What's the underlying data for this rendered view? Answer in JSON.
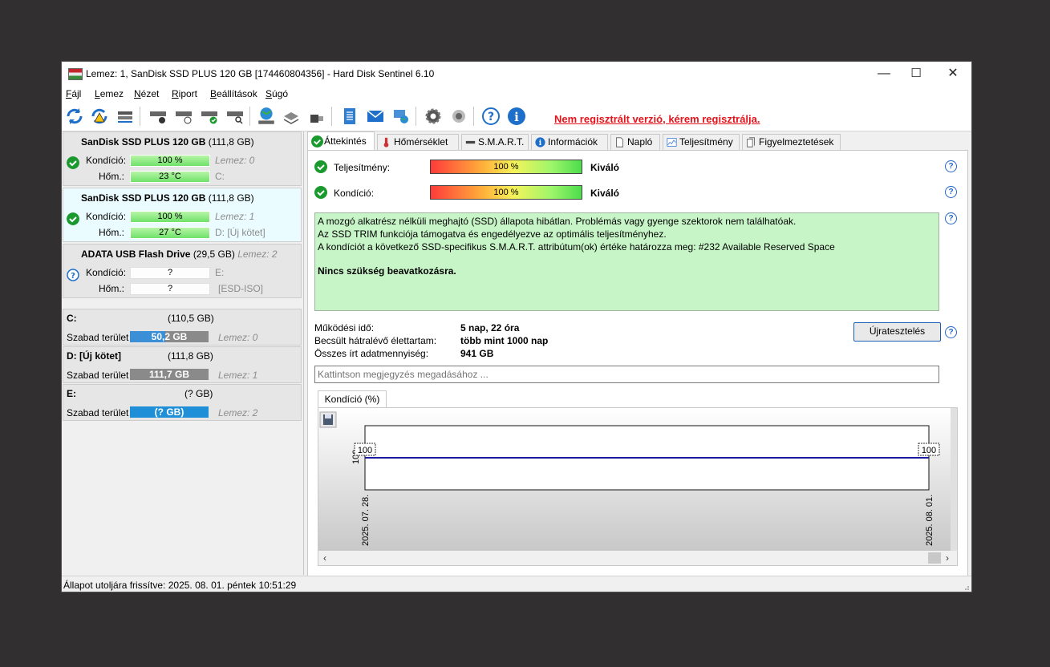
{
  "window": {
    "title": "Lemez: 1, SanDisk SSD PLUS 120 GB [174460804356]  -  Hard Disk Sentinel 6.10",
    "minimize": "—",
    "maximize": "☐",
    "close": "✕"
  },
  "menu": [
    "Fájl",
    "Lemez",
    "Nézet",
    "Riport",
    "Beállítások",
    "Súgó"
  ],
  "toolbar": {
    "register_link": "Nem regisztrált verzió, kérem regisztrálja."
  },
  "disks": [
    {
      "name": "SanDisk SSD PLUS 120 GB",
      "size": "(111,8 GB)",
      "lemez": "",
      "cond_label": "Kondíció:",
      "cond_value": "100 %",
      "cond_disk": "Lemez: 0",
      "temp_label": "Hőm.:",
      "temp_value": "23 °C",
      "drive": "C:"
    },
    {
      "name": "SanDisk SSD PLUS 120 GB",
      "size": "(111,8 GB)",
      "lemez": "",
      "cond_label": "Kondíció:",
      "cond_value": "100 %",
      "cond_disk": "Lemez: 1",
      "temp_label": "Hőm.:",
      "temp_value": "27 °C",
      "drive": "D: [Új kötet]"
    },
    {
      "name": "ADATA   USB Flash Drive",
      "size": "(29,5 GB)",
      "lemez": "Lemez: 2",
      "cond_label": "Kondíció:",
      "cond_value": "?",
      "cond_disk": "E:",
      "temp_label": "Hőm.:",
      "temp_value": "?",
      "drive": "[ESD-ISO]"
    }
  ],
  "volumes": [
    {
      "name": "C:",
      "size": "(110,5 GB)",
      "free_label": "Szabad terület",
      "free": "50,2 GB",
      "disk": "Lemez: 0",
      "color": "#3a8fd6"
    },
    {
      "name": "D: [Új kötet]",
      "size": "(111,8 GB)",
      "free_label": "Szabad terület",
      "free": "111,7 GB",
      "disk": "Lemez: 1",
      "color": "#8a8a8a"
    },
    {
      "name": "E:",
      "size": "(? GB)",
      "free_label": "Szabad terület",
      "free": "(? GB)",
      "disk": "Lemez: 2",
      "color": "#1f8fd8"
    }
  ],
  "tabs": [
    "Áttekintés",
    "Hőmérséklet",
    "S.M.A.R.T.",
    "Információk",
    "Napló",
    "Teljesítmény",
    "Figyelmeztetések"
  ],
  "overview": {
    "performance_label": "Teljesítmény:",
    "performance_value": "100 %",
    "performance_rating": "Kiváló",
    "condition_label": "Kondíció:",
    "condition_value": "100 %",
    "condition_rating": "Kiváló",
    "info_lines": [
      "A mozgó alkatrész nélküli meghajtó (SSD) állapota hibátlan. Problémás vagy gyenge szektorok nem találhatóak.",
      "Az SSD TRIM funkciója támogatva és engedélyezve az optimális teljesítményhez.",
      "A kondíciót a következő SSD-specifikus S.M.A.R.T. attribútum(ok) értéke határozza meg:  #232 Available Reserved Space"
    ],
    "info_bold": "Nincs szükség beavatkozásra.",
    "uptime_label": "Működési idő:",
    "uptime_value": "5 nap, 22 óra",
    "lifetime_label": "Becsült hátralévő élettartam:",
    "lifetime_value": "több mint 1000 nap",
    "written_label": "Összes írt adatmennyiség:",
    "written_value": "941 GB",
    "retest_button": "Újratesztelés",
    "note_placeholder": "Kattintson megjegyzés megadásához ..."
  },
  "chart_tab": "Kondíció  (%)",
  "chart_data": {
    "type": "line",
    "x": [
      "2025. 07. 28.",
      "2025. 08. 01."
    ],
    "series": [
      {
        "values": [
          100,
          100
        ]
      }
    ],
    "y_tick": "100",
    "point_labels": [
      "100",
      "100"
    ],
    "color": "#1a1aa0"
  },
  "status": {
    "text": "Állapot utoljára frissítve: 2025. 08. 01. péntek 10:51:29"
  }
}
